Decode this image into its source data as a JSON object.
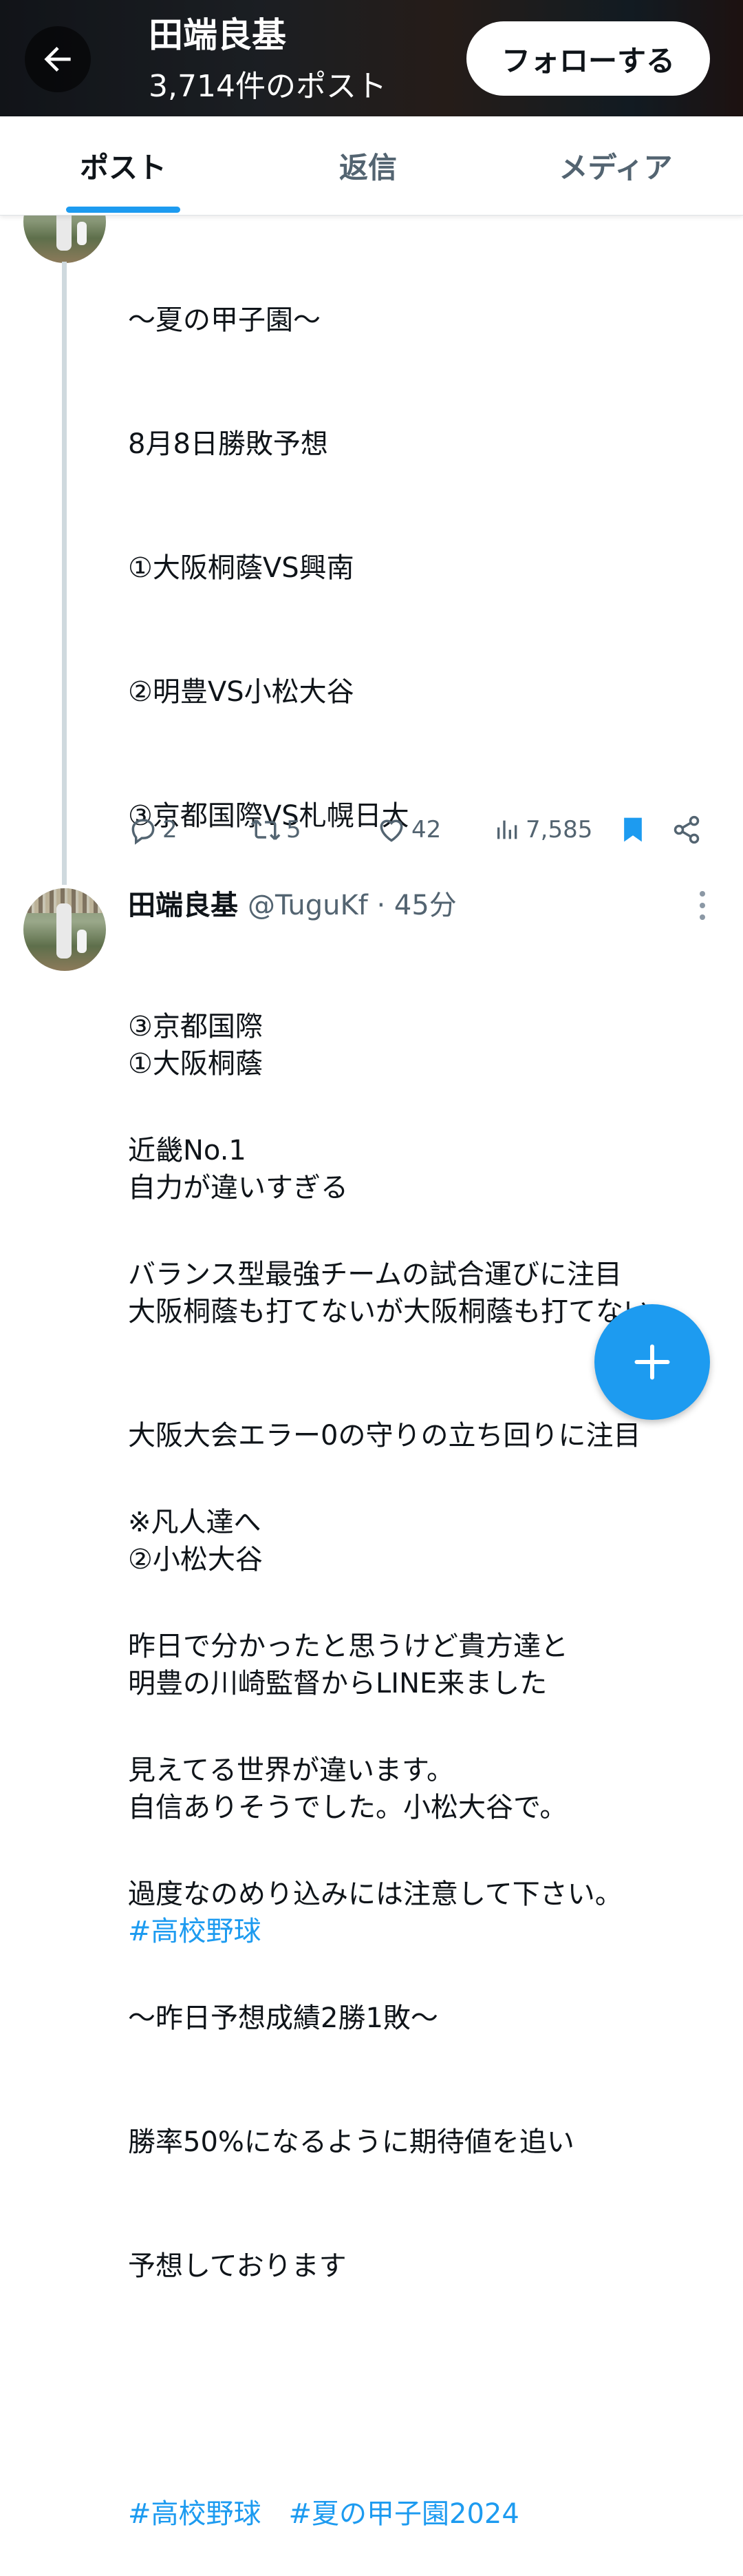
{
  "header": {
    "name": "田端良基",
    "post_count": "3,714件のポスト",
    "follow_label": "フォローする"
  },
  "tabs": [
    {
      "label": "ポスト",
      "active": true
    },
    {
      "label": "返信",
      "active": false
    },
    {
      "label": "メディア",
      "active": false
    }
  ],
  "tweet1": {
    "lines": [
      "〜夏の甲子園〜",
      "8月8日勝敗予想",
      "①大阪桐蔭VS興南",
      "②明豊VS小松大谷",
      "③京都国際VS札幌日大",
      "",
      "①大阪桐蔭",
      "自力が違いすぎる",
      "大阪桐蔭も打てないが大阪桐蔭も打てない",
      "大阪大会エラー0の守りの立ち回りに注目",
      "②小松大谷",
      "明豊の川崎監督からLINE来ました",
      "自信ありそうでした。小松大谷で。"
    ],
    "hashtag": "#高校野球",
    "replies": "2",
    "reposts": "5",
    "likes": "42",
    "views": "7,585"
  },
  "tweet2": {
    "name": "田端良基",
    "handle": "@TuguKf · 45分",
    "lines": [
      "③京都国際",
      "近畿No.1",
      "バランス型最強チームの試合運びに注目",
      "",
      "※凡人達へ",
      "昨日で分かったと思うけど貴方達と",
      "見えてる世界が違います。",
      "過度なのめり込みには注意して下さい。",
      "〜昨日予想成績2勝1敗〜",
      "勝率50%になるように期待値を追い",
      "予想しております",
      ""
    ],
    "hashtags": "#高校野球　#夏の甲子園2024"
  },
  "colors": {
    "accent": "#1d9bf0",
    "text": "#0f1419",
    "secondary": "#536471"
  },
  "icons": [
    "back-arrow-icon",
    "reply-icon",
    "repost-icon",
    "like-icon",
    "views-icon",
    "bookmark-icon",
    "share-icon",
    "more-icon",
    "compose-plus-icon"
  ]
}
